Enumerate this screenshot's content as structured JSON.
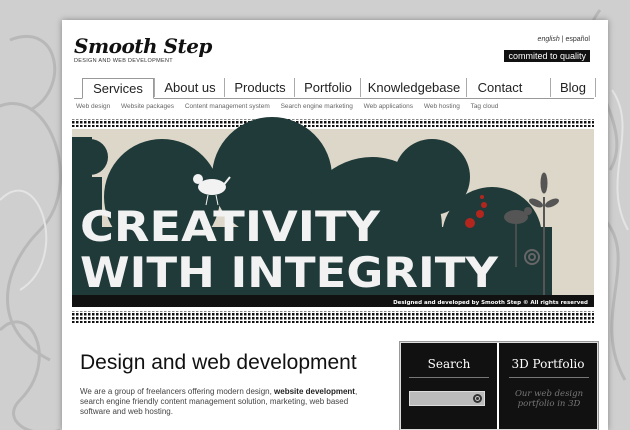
{
  "brand": {
    "name": "Smooth Step",
    "tagline": "DESIGN AND WEB DEVELOPMENT"
  },
  "lang": {
    "english": "english",
    "sep": "|",
    "spanish": "español"
  },
  "quality_badge": "commited to quality",
  "nav": {
    "services": "Services",
    "about": "About us",
    "products": "Products",
    "portfolio": "Portfolio",
    "knowledgebase": "Knowledgebase",
    "contact": "Contact",
    "blog": "Blog"
  },
  "subnav": {
    "web_design": "Web design",
    "web_packages": "Website packages",
    "cms": "Content management system",
    "sem": "Search engine marketing",
    "web_apps": "Web applications",
    "hosting": "Web hosting",
    "tag_cloud": "Tag cloud"
  },
  "banner": {
    "line1": "CREATIVITY",
    "line2": "WITH INTEGRITY",
    "credit": "Designed and developed by Smooth Step © All rights reserved"
  },
  "main": {
    "headline": "Design and web development",
    "intro_pre": "We are a group of freelancers offering modern design, ",
    "intro_bold": "website development",
    "intro_post": ", search engine friendly content management solution, marketing, web based software and web hosting."
  },
  "sidebar": {
    "search_title": "Search",
    "portfolio_title": "3D Portfolio",
    "portfolio_text": "Our web design portfolio in 3D"
  },
  "colors": {
    "banner_teal": "#1f3a39",
    "banner_cream": "#ddd7c9",
    "accent_red": "#b3261e"
  }
}
